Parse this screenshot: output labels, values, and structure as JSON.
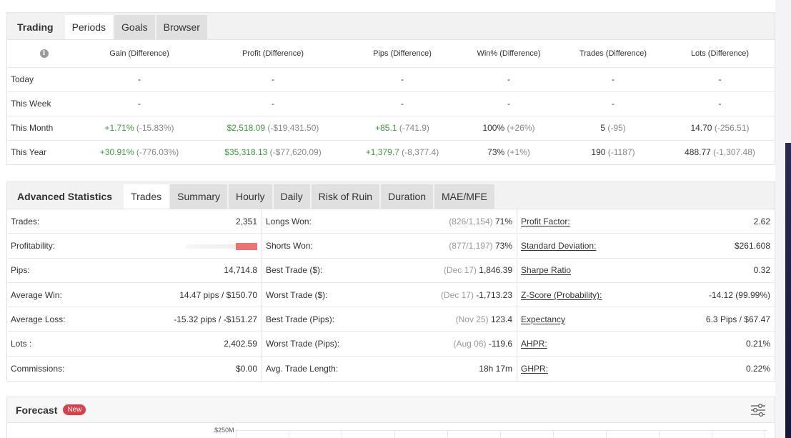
{
  "periods_panel": {
    "title": "Trading",
    "tabs": [
      "Periods",
      "Goals",
      "Browser"
    ],
    "active_tab": 0,
    "columns": [
      "Gain (Difference)",
      "Profit (Difference)",
      "Pips (Difference)",
      "Win% (Difference)",
      "Trades (Difference)",
      "Lots (Difference)"
    ],
    "rows": [
      {
        "label": "Today",
        "cells": [
          {
            "v": "-",
            "d": ""
          },
          {
            "v": "-",
            "d": ""
          },
          {
            "v": "-",
            "d": ""
          },
          {
            "v": "-",
            "d": ""
          },
          {
            "v": "-",
            "d": ""
          },
          {
            "v": "-",
            "d": ""
          }
        ]
      },
      {
        "label": "This Week",
        "cells": [
          {
            "v": "-",
            "d": ""
          },
          {
            "v": "-",
            "d": ""
          },
          {
            "v": "-",
            "d": ""
          },
          {
            "v": "-",
            "d": ""
          },
          {
            "v": "-",
            "d": ""
          },
          {
            "v": "-",
            "d": ""
          }
        ]
      },
      {
        "label": "This Month",
        "cells": [
          {
            "v": "+1.71%",
            "d": "(-15.83%)",
            "pos": true
          },
          {
            "v": "$2,518.09",
            "d": "(-$19,431.50)",
            "pos": true
          },
          {
            "v": "+85.1",
            "d": "(-741.9)",
            "pos": true
          },
          {
            "v": "100%",
            "d": "(+26%)"
          },
          {
            "v": "5",
            "d": "(-95)"
          },
          {
            "v": "14.70",
            "d": "(-256.51)"
          }
        ]
      },
      {
        "label": "This Year",
        "cells": [
          {
            "v": "+30.91%",
            "d": "(-776.03%)",
            "pos": true
          },
          {
            "v": "$35,318.13",
            "d": "(-$77,620.09)",
            "pos": true
          },
          {
            "v": "+1,379.7",
            "d": "(-8,377.4)",
            "pos": true
          },
          {
            "v": "73%",
            "d": "(+1%)"
          },
          {
            "v": "190",
            "d": "(-1187)"
          },
          {
            "v": "488.77",
            "d": "(-1,307.48)"
          }
        ]
      }
    ]
  },
  "advanced_panel": {
    "title": "Advanced Statistics",
    "tabs": [
      "Trades",
      "Summary",
      "Hourly",
      "Daily",
      "Risk of Ruin",
      "Duration",
      "MAE/MFE"
    ],
    "active_tab": 0,
    "col1": [
      {
        "label": "Trades:",
        "value": "2,351"
      },
      {
        "label": "Profitability:",
        "value": ""
      },
      {
        "label": "Pips:",
        "value": "14,714.8"
      },
      {
        "label": "Average Win:",
        "value": "14.47 pips / $150.70"
      },
      {
        "label": "Average Loss:",
        "value": "-15.32 pips / -$151.27"
      },
      {
        "label": "Lots :",
        "value": "2,402.59"
      },
      {
        "label": "Commissions:",
        "value": "$0.00"
      }
    ],
    "col2": [
      {
        "label": "Longs Won:",
        "muted": "(826/1,154)",
        "value": "71%"
      },
      {
        "label": "Shorts Won:",
        "muted": "(877/1,197)",
        "value": "73%"
      },
      {
        "label": "Best Trade ($):",
        "muted": "(Dec 17)",
        "value": "1,846.39"
      },
      {
        "label": "Worst Trade ($):",
        "muted": "(Dec 17)",
        "value": "-1,713.23"
      },
      {
        "label": "Best Trade (Pips):",
        "muted": "(Nov 25)",
        "value": "123.4"
      },
      {
        "label": "Worst Trade (Pips):",
        "muted": "(Aug 06)",
        "value": "-119.6"
      },
      {
        "label": "Avg. Trade Length:",
        "muted": "",
        "value": "18h 17m"
      }
    ],
    "col3": [
      {
        "label": "Profit Factor:",
        "value": "2.62"
      },
      {
        "label": "Standard Deviation:",
        "value": "$261.608"
      },
      {
        "label": "Sharpe Ratio",
        "value": "0.32"
      },
      {
        "label": "Z-Score (Probability):",
        "value": "-14.12 (99.99%)"
      },
      {
        "label": "Expectancy",
        "value": "6.3 Pips / $67.47"
      },
      {
        "label": "AHPR:",
        "value": "0.21%"
      },
      {
        "label": "GHPR:",
        "value": "0.22%"
      }
    ]
  },
  "forecast_panel": {
    "title": "Forecast",
    "badge": "New",
    "axis_top_label": "$250M",
    "settings_icon": "sliders-icon"
  },
  "colors": {
    "positive": "#3a9c3a",
    "muted": "#888888",
    "badge": "#d9414a",
    "profitability_bar": "#ee7272"
  }
}
